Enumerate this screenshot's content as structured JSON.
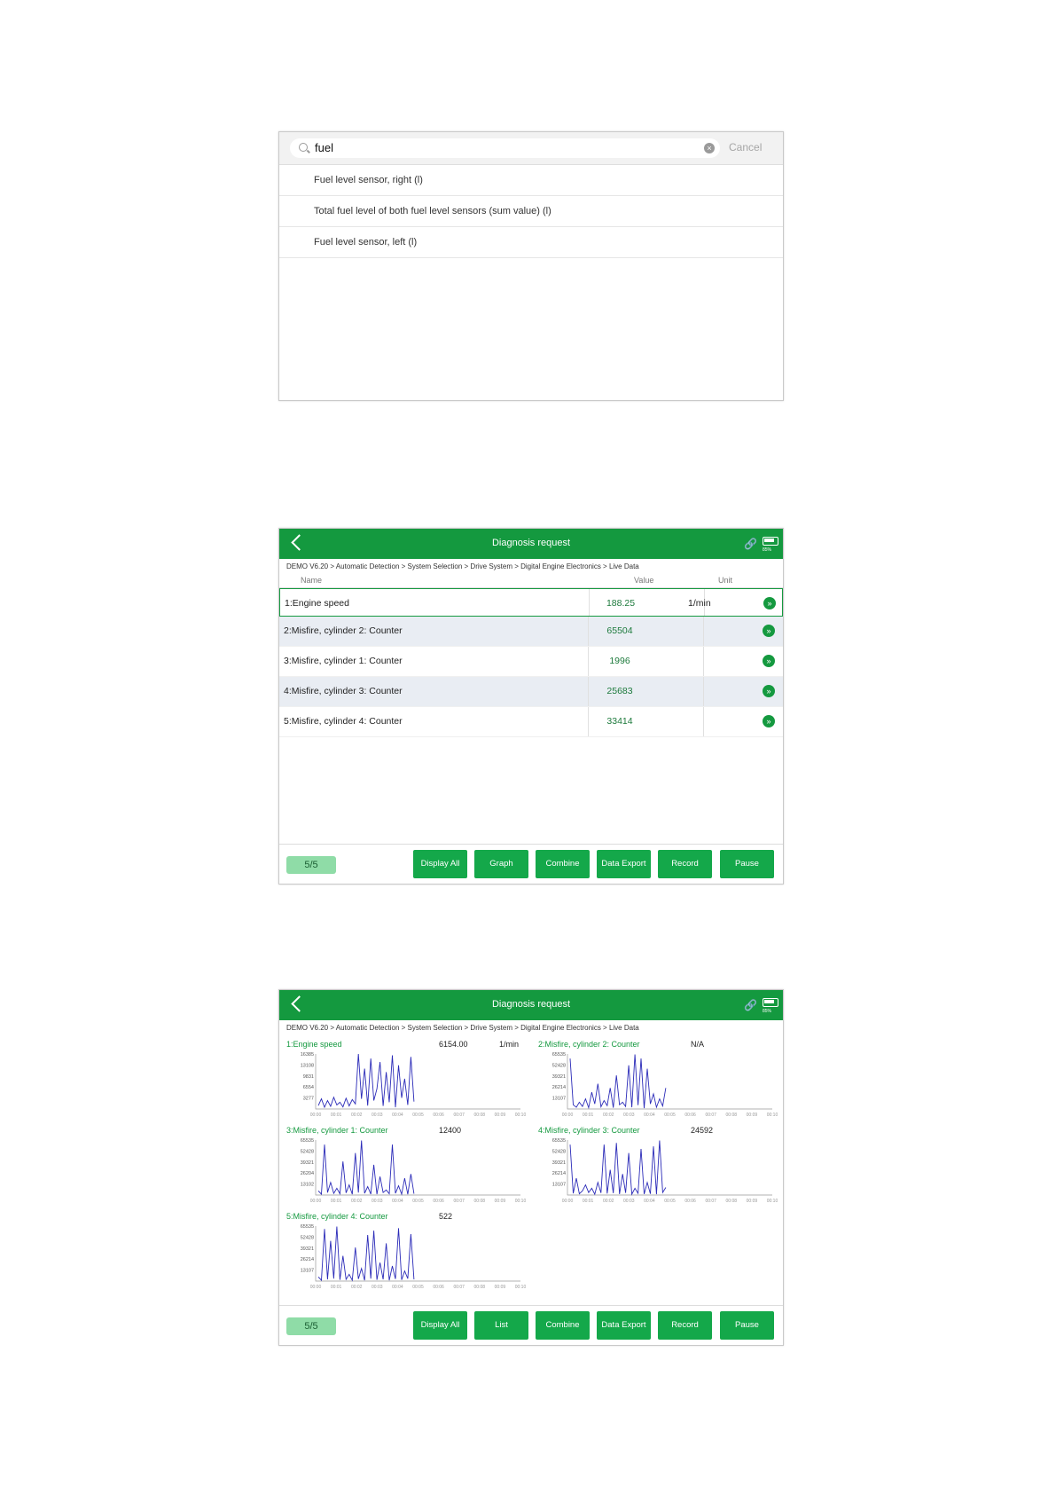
{
  "search_screen": {
    "query": "fuel",
    "cancel_label": "Cancel",
    "results": [
      "Fuel level sensor, right (l)",
      "Total fuel level of both fuel level sensors (sum value) (l)",
      "Fuel level sensor, left (l)"
    ]
  },
  "list_screen": {
    "title": "Diagnosis request",
    "battery": "85%",
    "breadcrumb": "DEMO V6.20 > Automatic Detection  > System Selection  > Drive System  > Digital Engine Electronics  > Live Data",
    "columns": {
      "name": "Name",
      "value": "Value",
      "unit": "Unit"
    },
    "rows": [
      {
        "name": "1:Engine speed",
        "value": "188.25",
        "unit": "1/min"
      },
      {
        "name": "2:Misfire, cylinder 2: Counter",
        "value": "65504",
        "unit": ""
      },
      {
        "name": "3:Misfire, cylinder 1: Counter",
        "value": "1996",
        "unit": ""
      },
      {
        "name": "4:Misfire, cylinder 3: Counter",
        "value": "25683",
        "unit": ""
      },
      {
        "name": "5:Misfire, cylinder 4: Counter",
        "value": "33414",
        "unit": ""
      }
    ],
    "page": "5/5",
    "buttons": [
      "Display All",
      "Graph",
      "Combine",
      "Data Export",
      "Record",
      "Pause"
    ]
  },
  "graph_screen": {
    "title": "Diagnosis request",
    "battery": "85%",
    "breadcrumb": "DEMO V6.20 > Automatic Detection  > System Selection  > Drive System  > Digital Engine Electronics  > Live Data",
    "page": "5/5",
    "buttons": [
      "Display All",
      "List",
      "Combine",
      "Data Export",
      "Record",
      "Pause"
    ]
  },
  "chart_data": [
    {
      "type": "line",
      "title": "1:Engine speed",
      "value": "6154.00",
      "unit": "1/min",
      "yticks": [
        "16385",
        "13108",
        "9831",
        "6554",
        "3277"
      ],
      "xticks": [
        "00:00",
        "00:01",
        "00:02",
        "00:03",
        "00:04",
        "00:05",
        "00:06",
        "00:07",
        "00:08",
        "00:09",
        "00:10"
      ],
      "ylim": [
        0,
        16385
      ],
      "series": [
        {
          "values": [
            1000,
            3000,
            500,
            2500,
            800,
            3500,
            1200,
            2000,
            600,
            3200,
            900,
            2800,
            1500,
            16385,
            3000,
            12000,
            1000,
            15000,
            2500,
            6000,
            14000,
            900,
            11000,
            2000,
            16000,
            500,
            13000,
            3300,
            9000,
            1200,
            15500,
            2200
          ]
        }
      ]
    },
    {
      "type": "line",
      "title": "2:Misfire, cylinder 2: Counter",
      "value": "N/A",
      "unit": "",
      "yticks": [
        "65535",
        "52428",
        "39321",
        "26214",
        "13107"
      ],
      "xticks": [
        "00:00",
        "00:01",
        "00:02",
        "00:03",
        "00:04",
        "00:05",
        "00:06",
        "00:07",
        "00:08",
        "00:09",
        "00:10"
      ],
      "ylim": [
        0,
        65535
      ],
      "series": [
        {
          "values": [
            60000,
            5000,
            2000,
            8000,
            3000,
            12000,
            1500,
            20000,
            6000,
            30000,
            2500,
            10000,
            4000,
            25000,
            1500,
            40000,
            5000,
            8000,
            3000,
            52000,
            2000,
            65000,
            4500,
            60000,
            1000,
            48000,
            6000,
            18000,
            2000,
            12000,
            3500,
            25000
          ]
        }
      ]
    },
    {
      "type": "line",
      "title": "3:Misfire, cylinder 1: Counter",
      "value": "12400",
      "unit": "",
      "yticks": [
        "65535",
        "52428",
        "39321",
        "26204",
        "13102"
      ],
      "xticks": [
        "00:00",
        "00:01",
        "00:02",
        "00:03",
        "00:04",
        "00:05",
        "00:06",
        "00:07",
        "00:08",
        "00:09",
        "00:10"
      ],
      "ylim": [
        0,
        65535
      ],
      "series": [
        {
          "values": [
            5000,
            1000,
            60000,
            3000,
            15000,
            2000,
            8000,
            1500,
            40000,
            2500,
            12000,
            1000,
            50000,
            3000,
            65000,
            2000,
            10000,
            1200,
            36000,
            900,
            22000,
            3000,
            6000,
            1500,
            60000,
            2000,
            11000,
            1000,
            20000,
            800,
            25000,
            1500
          ]
        }
      ]
    },
    {
      "type": "line",
      "title": "4:Misfire, cylinder 3: Counter",
      "value": "24592",
      "unit": "",
      "yticks": [
        "65535",
        "52428",
        "39321",
        "26214",
        "13107"
      ],
      "xticks": [
        "00:00",
        "00:01",
        "00:02",
        "00:03",
        "00:04",
        "00:05",
        "00:06",
        "00:07",
        "00:08",
        "00:09",
        "00:10"
      ],
      "ylim": [
        0,
        65535
      ],
      "series": [
        {
          "values": [
            60000,
            2000,
            20000,
            1500,
            5000,
            12000,
            3000,
            8000,
            1000,
            15000,
            2500,
            60000,
            1800,
            30000,
            2200,
            62000,
            1200,
            25000,
            2500,
            50000,
            1000,
            8000,
            2000,
            55000,
            1200,
            15000,
            1500,
            58000,
            900,
            65000,
            3000,
            9000
          ]
        }
      ]
    },
    {
      "type": "line",
      "title": "5:Misfire, cylinder 4: Counter",
      "value": "522",
      "unit": "",
      "yticks": [
        "65535",
        "52428",
        "39321",
        "26214",
        "13107"
      ],
      "xticks": [
        "00:00",
        "00:01",
        "00:02",
        "00:03",
        "00:04",
        "00:05",
        "00:06",
        "00:07",
        "00:08",
        "00:09",
        "00:10"
      ],
      "ylim": [
        0,
        65535
      ],
      "series": [
        {
          "values": [
            5000,
            1000,
            62000,
            2000,
            48000,
            3000,
            65000,
            1500,
            30000,
            2000,
            8000,
            1000,
            40000,
            2500,
            15000,
            1000,
            55000,
            3000,
            60000,
            1500,
            22000,
            2000,
            45000,
            1000,
            18000,
            2500,
            63000,
            1500,
            12000,
            3000,
            56000,
            2000
          ]
        }
      ]
    }
  ]
}
